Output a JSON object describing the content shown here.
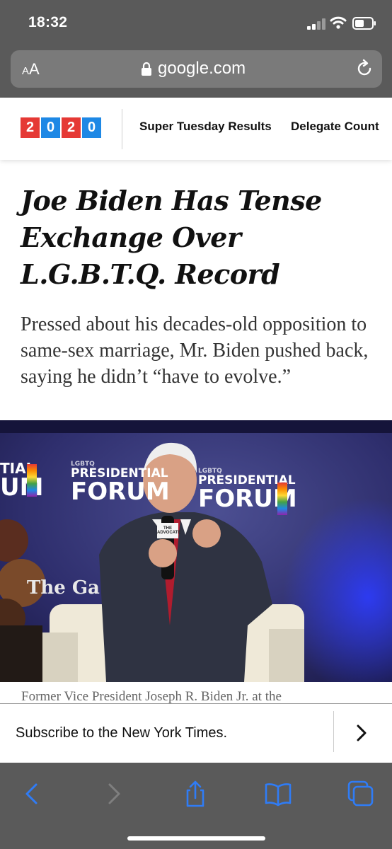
{
  "status": {
    "time": "18:32"
  },
  "browser": {
    "aa_label_small": "A",
    "aa_label_big": "A",
    "domain": "google.com"
  },
  "nav": {
    "logo_digits": [
      "2",
      "0",
      "2",
      "0"
    ],
    "links": [
      "Super Tuesday Results",
      "Delegate Count"
    ]
  },
  "article": {
    "headline": "Joe Biden Has Tense Exchange Over L.G.B.T.Q. Record",
    "summary": "Pressed about his decades-old opposition to same-sex marriage, Mr. Biden pushed back, saying he didn’t “have to evolve.”",
    "photo": {
      "banner_text_1_small": "LGBTQ",
      "banner_text_1a": "PRESIDENTIAL",
      "banner_text_1b": "FORUM",
      "banner_text_left_a": "TIAL",
      "banner_text_left_b": "UM",
      "sign_text": "The Ga",
      "mic_label": "THE ADVOCATE"
    },
    "caption": "Former Vice President Joseph R. Biden Jr. at the"
  },
  "subscribe": {
    "text": "Subscribe to the New York Times."
  },
  "toolbar": {
    "icons": [
      "back-icon",
      "forward-icon",
      "share-icon",
      "bookmarks-icon",
      "tabs-icon"
    ]
  },
  "colors": {
    "logo_red": "#e53935",
    "logo_blue": "#1e88e5",
    "ios_blue": "#2f7cf6",
    "chrome": "#5a5a5a"
  }
}
